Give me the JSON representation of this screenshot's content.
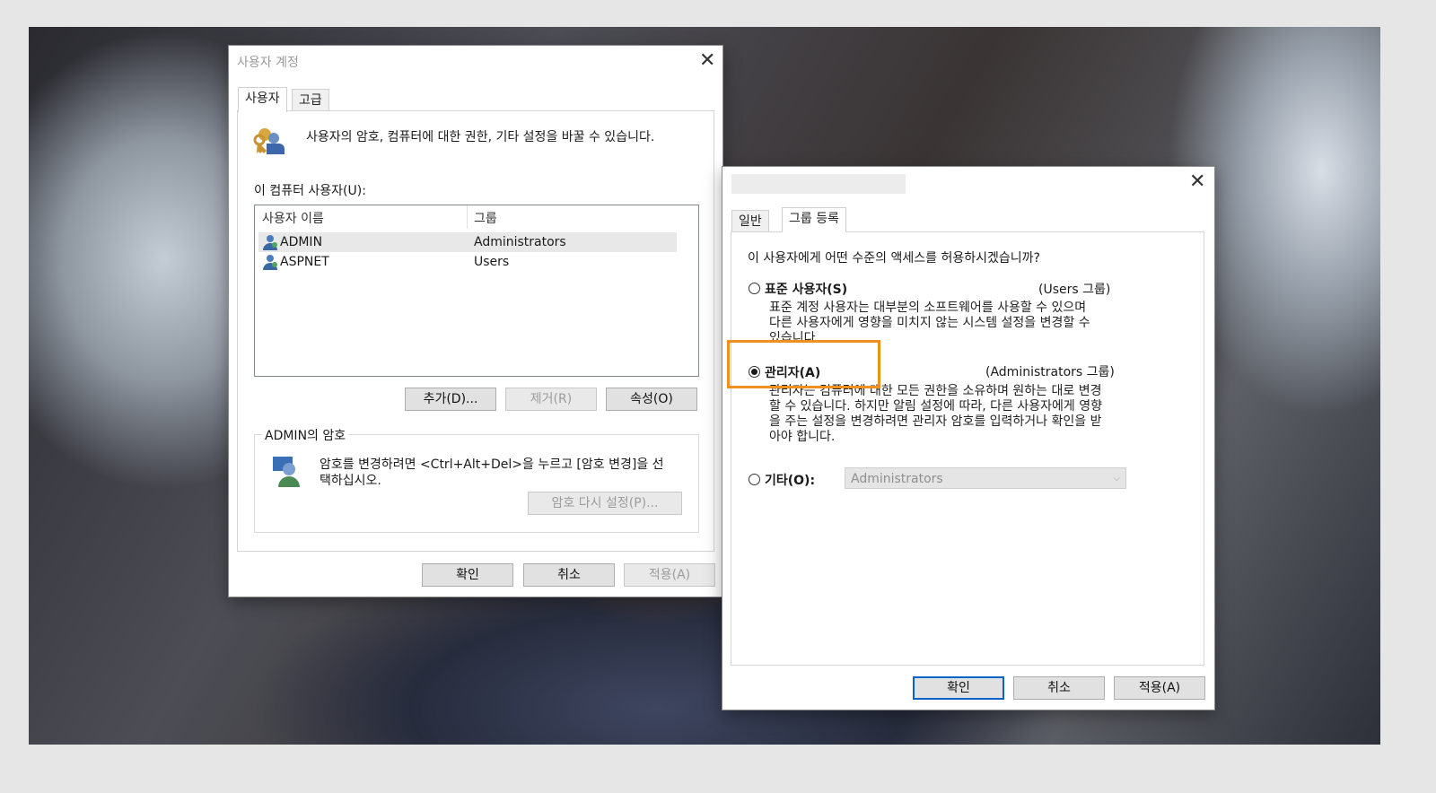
{
  "user_accounts": {
    "title": "사용자 계정",
    "tabs": [
      "사용자",
      "고급"
    ],
    "intro": "사용자의 암호, 컴퓨터에 대한 권한, 기타 설정을 바꿀 수 있습니다.",
    "users_label": "이 컴퓨터 사용자(U):",
    "columns": [
      "사용자 이름",
      "그룹"
    ],
    "rows": [
      {
        "name": "ADMIN",
        "group": "Administrators"
      },
      {
        "name": "ASPNET",
        "group": "Users"
      }
    ],
    "buttons": {
      "add": "추가(D)...",
      "remove": "제거(R)",
      "properties": "속성(O)"
    },
    "password_group_title": "ADMIN의 암호",
    "password_text_1": "암호를 변경하려면 <Ctrl+Alt+Del>을 누르고 [암호 변경]을 선",
    "password_text_2": "택하십시오.",
    "reset_password": "암호 다시 설정(P)...",
    "footer": {
      "ok": "확인",
      "cancel": "취소",
      "apply": "적용(A)"
    }
  },
  "properties": {
    "tabs": [
      "일반",
      "그룹 등록"
    ],
    "question": "이 사용자에게 어떤 수준의 액세스를 허용하시겠습니까?",
    "standard": {
      "label": "표준 사용자(S)",
      "group": "(Users 그룹)",
      "desc_1": "표준 계정 사용자는 대부분의 소프트웨어를 사용할 수 있으며",
      "desc_2": "다른 사용자에게 영향을 미치지 않는 시스템 설정을 변경할 수",
      "desc_3": "있습니다."
    },
    "admin": {
      "label": "관리자(A)",
      "group": "(Administrators 그룹)",
      "desc_1": "관리자는 컴퓨터에 대한 모든 권한을 소유하며 원하는 대로 변경",
      "desc_2": "할 수 있습니다. 하지만 알림 설정에 따라, 다른 사용자에게 영향",
      "desc_3": "을 주는 설정을 변경하려면 관리자 암호를 입력하거나 확인을 받",
      "desc_4": "아야 합니다."
    },
    "other": {
      "label": "기타(O):",
      "value": "Administrators"
    },
    "footer": {
      "ok": "확인",
      "cancel": "취소",
      "apply": "적용(A)"
    }
  },
  "colors": {
    "highlight": "#f0911f",
    "default_button_border": "#0a64c8"
  }
}
